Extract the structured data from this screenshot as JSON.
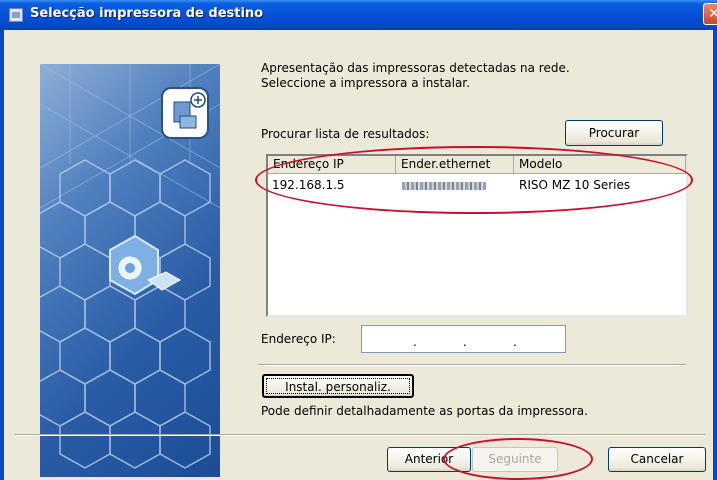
{
  "window": {
    "title": "Selecção impressora de destino",
    "close_symbol": "✕"
  },
  "intro": {
    "line1": "Apresentação das impressoras detectadas na rede.",
    "line2": "Seleccione a impressora a instalar."
  },
  "search": {
    "label": "Procurar lista de resultados:",
    "button": "Procurar"
  },
  "list": {
    "columns": [
      "Endereço IP",
      "Ender.ethernet",
      "Modelo"
    ],
    "rows": [
      {
        "ip": "192.168.1.5",
        "model": "RISO MZ 10 Series"
      }
    ]
  },
  "ip_field": {
    "label": "Endereço IP:",
    "dots": [
      ".",
      ".",
      "."
    ]
  },
  "custom": {
    "button": "Instal. personaliz.",
    "description": "Pode definir detalhadamente as portas da impressora."
  },
  "footer": {
    "back": "Anterior",
    "next": "Seguinte",
    "cancel": "Cancelar"
  },
  "colors": {
    "title_bar": "#0651D8",
    "dialog_bg": "#ECE9D8",
    "highlight_ellipse": "#C8102E"
  }
}
